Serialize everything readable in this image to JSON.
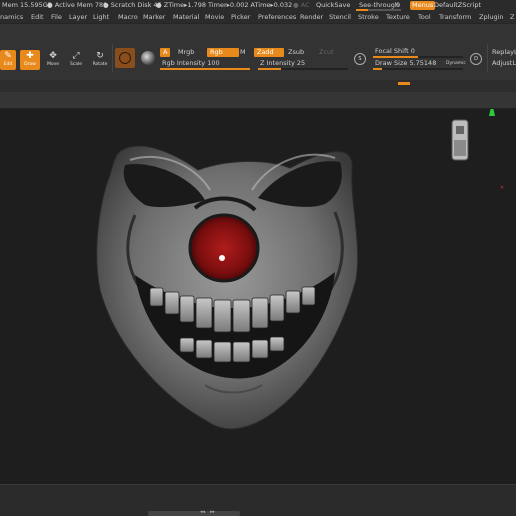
{
  "statusbar": {
    "mem": "Mem 15.595GB",
    "active_mem": "● Active Mem 788",
    "scratch": "● Scratch Disk 45",
    "ztime": "● ZTime▸1.798 Timer▸0.002 ATime▸0.032",
    "ac": "● AC",
    "quicksave": "QuickSave",
    "see_through": "See-through",
    "see_through_value": "0",
    "menus": "Menus",
    "default_zscript": "DefaultZScript"
  },
  "menubar": {
    "items": [
      "namics",
      "Edit",
      "File",
      "Layer",
      "Light",
      "Macro",
      "Marker",
      "Material",
      "Movie",
      "Picker",
      "Preferences",
      "Render",
      "Stencil",
      "Stroke",
      "Texture",
      "Tool",
      "Transform",
      "Zplugin",
      "Z"
    ]
  },
  "toolbar": {
    "tools": [
      {
        "label": "Edit",
        "glyph": "✎"
      },
      {
        "label": "Draw",
        "glyph": "✚"
      },
      {
        "label": "Move",
        "glyph": "✥"
      },
      {
        "label": "Scale",
        "glyph": "⤢"
      },
      {
        "label": "Rotate",
        "glyph": "↻"
      }
    ],
    "a_label": "A",
    "mrgb_label": "Mrgb",
    "rgb_label": "Rgb",
    "m_label": "M",
    "zadd_label": "Zadd",
    "zsub_label": "Zsub",
    "zcut_label": "Zcut",
    "rgb_intensity": "Rgb Intensity 100",
    "z_intensity": "Z Intensity 25",
    "focal_shift": "Focal Shift 0",
    "draw_size": "Draw Size 5.75148",
    "dynamic": "Dynamic",
    "s_label": "S",
    "d_label": "D",
    "replay_label": "ReplayLa",
    "adjust_label": "AdjustLa",
    "rgb_intensity_level": 1.0,
    "z_intensity_level": 0.25,
    "focal_shift_level": 0.5,
    "draw_size_level": 0.1
  },
  "viewport": {
    "accent_color": "#e8891c",
    "nose_color": "#8a1414"
  },
  "bottom": {
    "left_arrows": "◂◂",
    "right_arrows": "▸▸"
  }
}
